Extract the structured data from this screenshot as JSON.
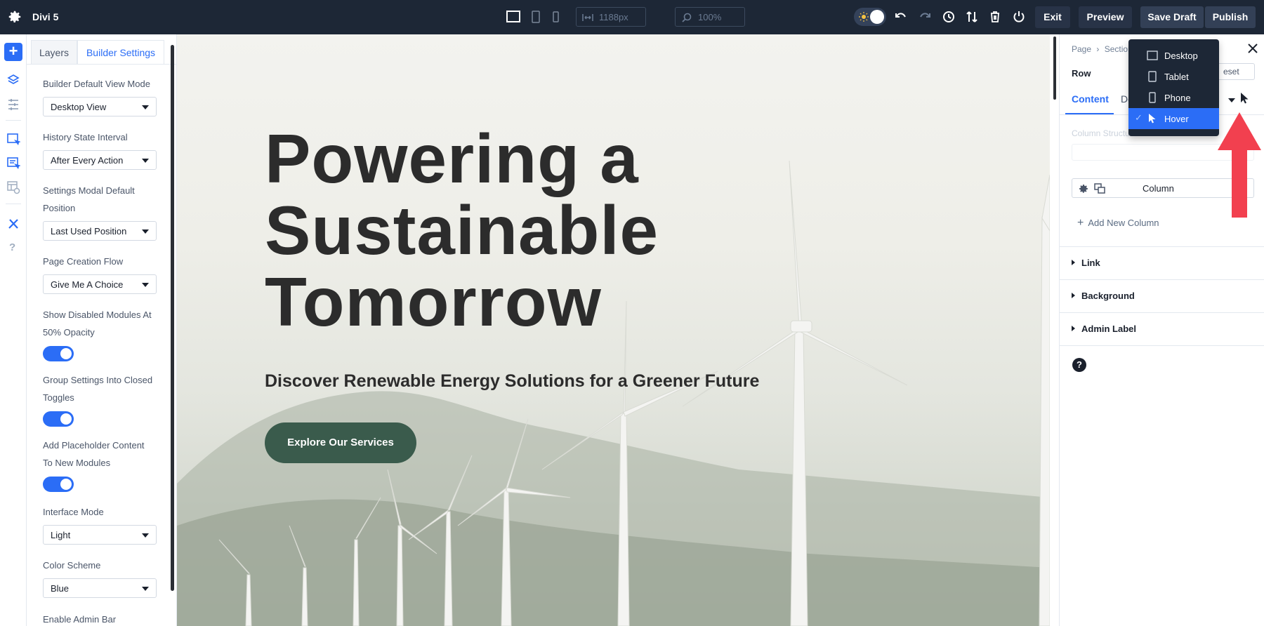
{
  "app": {
    "title": "Divi 5"
  },
  "topbar": {
    "width_value": "1188px",
    "zoom_value": "100%",
    "exit_label": "Exit",
    "preview_label": "Preview",
    "save_draft_label": "Save Draft",
    "publish_label": "Publish",
    "icons": [
      "gear-icon",
      "desktop-view-icon",
      "tablet-view-icon",
      "phone-view-icon",
      "width-icon",
      "zoom-icon",
      "sun-icon",
      "undo-icon",
      "redo-icon",
      "history-icon",
      "sort-icon",
      "trash-icon",
      "power-icon"
    ]
  },
  "rail": {
    "icons": [
      "add-icon",
      "layers-icon",
      "settings-list-icon",
      "page-module-icon",
      "page-settings-icon",
      "template-icon",
      "tools-icon",
      "help-icon"
    ],
    "help_glyph": "?"
  },
  "left_panel": {
    "tabs": [
      "Layers",
      "Builder Settings"
    ],
    "active_tab": "Builder Settings",
    "settings": {
      "default_view_mode_label": "Builder Default View Mode",
      "default_view_mode_value": "Desktop View",
      "history_interval_label": "History State Interval",
      "history_interval_value": "After Every Action",
      "modal_position_label_1": "Settings Modal Default",
      "modal_position_label_2": "Position",
      "modal_position_value": "Last Used Position",
      "creation_flow_label": "Page Creation Flow",
      "creation_flow_value": "Give Me A Choice",
      "disabled_modules_label_1": "Show Disabled Modules At",
      "disabled_modules_label_2": "50% Opacity",
      "disabled_modules_on": true,
      "group_settings_label_1": "Group Settings Into Closed",
      "group_settings_label_2": "Toggles",
      "group_settings_on": true,
      "placeholder_label_1": "Add Placeholder Content",
      "placeholder_label_2": "To New Modules",
      "placeholder_on": true,
      "interface_mode_label": "Interface Mode",
      "interface_mode_value": "Light",
      "color_scheme_label": "Color Scheme",
      "color_scheme_value": "Blue",
      "admin_bar_label": "Enable Admin Bar"
    }
  },
  "hero": {
    "title_line_1": "Powering a",
    "title_line_2": "Sustainable",
    "title_line_3": "Tomorrow",
    "subtitle": "Discover Renewable Energy Solutions for a Greener Future",
    "button_label": "Explore Our Services",
    "button_color": "#3a5b4c"
  },
  "right_panel": {
    "breadcrumb_page": "Page",
    "breadcrumb_sep": "›",
    "breadcrumb_section": "Section",
    "title": "Row",
    "preset_label": "eset",
    "tabs": [
      "Content",
      "De"
    ],
    "active_tab": "Content",
    "column_structure_label": "Column Structure",
    "column_label": "Column",
    "add_column_label": "Add New Column",
    "add_plus": "+",
    "accordions": [
      "Link",
      "Background",
      "Admin Label"
    ],
    "help_glyph": "?"
  },
  "breakpoint_menu": {
    "items": [
      {
        "label": "Desktop",
        "icon": "desktop-icon"
      },
      {
        "label": "Tablet",
        "icon": "tablet-icon"
      },
      {
        "label": "Phone",
        "icon": "phone-icon"
      },
      {
        "label": "Hover",
        "icon": "cursor-icon"
      }
    ],
    "selected": "Hover",
    "check_glyph": "✓"
  },
  "colors": {
    "accent": "#2b6df6",
    "topbar": "#1d2736",
    "annotation_arrow": "#f2404f"
  }
}
